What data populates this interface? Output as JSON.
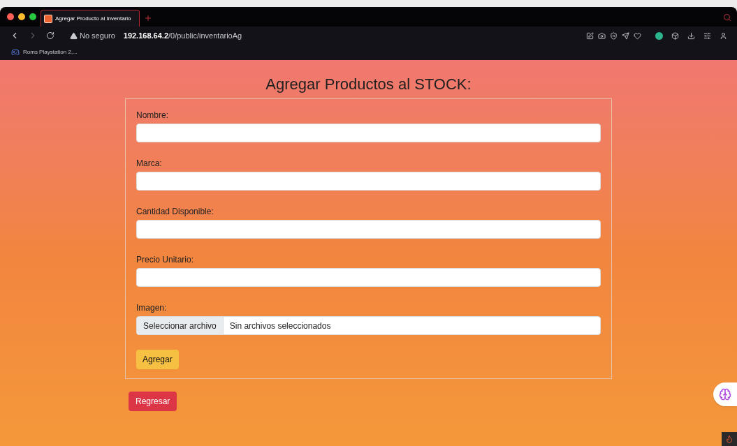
{
  "browser": {
    "tab": {
      "title": "Agregar Producto al Inventario",
      "selected": true
    },
    "security": "No seguro",
    "url_host": "192.168.64.2",
    "url_path": "/0/public/inventarioAg",
    "bookmarks": [
      "Roms Playstation 2,..."
    ]
  },
  "page": {
    "heading": "Agregar Productos al STOCK:",
    "fields": [
      {
        "kind": "text",
        "label": "Nombre:"
      },
      {
        "kind": "text",
        "label": "Marca:"
      },
      {
        "kind": "text",
        "label": "Cantidad Disponible:"
      },
      {
        "kind": "text",
        "label": "Precio Unitario:"
      },
      {
        "kind": "file",
        "label": "Imagen:",
        "button": "Seleccionar archivo",
        "value": "Sin archivos seleccionados"
      }
    ],
    "submit": "Agregar",
    "back": "Regresar"
  }
}
